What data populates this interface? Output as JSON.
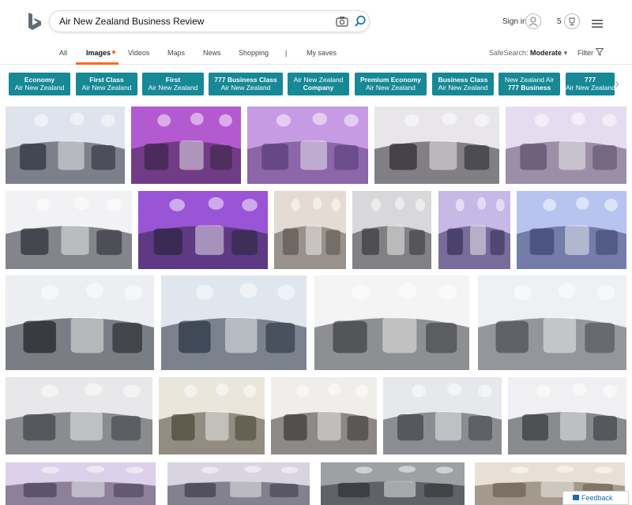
{
  "search": {
    "query": "Air New Zealand Business Review"
  },
  "header": {
    "signin_label": "Sign in",
    "rewards_count": "5"
  },
  "nav": {
    "tabs": [
      {
        "label": "All"
      },
      {
        "label": "Images"
      },
      {
        "label": "Videos"
      },
      {
        "label": "Maps"
      },
      {
        "label": "News"
      },
      {
        "label": "Shopping"
      },
      {
        "label": "|"
      },
      {
        "label": "My saves"
      }
    ],
    "safesearch_label": "SafeSearch:",
    "safesearch_value": "Moderate",
    "filter_label": "Filter"
  },
  "related": [
    {
      "line1": "Economy",
      "line2": "Air New Zealand"
    },
    {
      "line1": "First Class",
      "line2": "Air New Zealand"
    },
    {
      "line1": "First",
      "line2": "Air New Zealand"
    },
    {
      "line1": "777 Business Class",
      "line2": "Air New Zealand"
    },
    {
      "line1": "Air New Zealand",
      "line2": "Company"
    },
    {
      "line1": "Premium Economy",
      "line2": "Air New Zealand"
    },
    {
      "line1": "Business Class",
      "line2": "Air New Zealand"
    },
    {
      "line1": "New Zealand Air",
      "line2": "777 Business"
    },
    {
      "line1": "777",
      "line2": "Air New Zealand"
    }
  ],
  "colors": {
    "accent": "#f26d21",
    "chip_bg": "#168896",
    "link": "#1a66b7"
  },
  "feedback_label": "Feedback"
}
